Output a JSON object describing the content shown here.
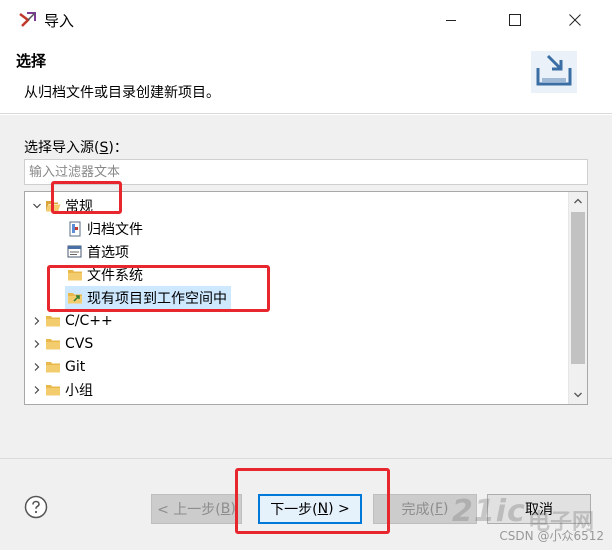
{
  "window": {
    "title": "导入",
    "icon": "eclipse-import-icon",
    "controls": [
      "minimize",
      "maximize",
      "close"
    ]
  },
  "header": {
    "title": "选择",
    "description": "从归档文件或目录创建新项目。",
    "graphic": "import-wizard-graphic"
  },
  "source": {
    "label_prefix": "选择导入源(",
    "label_mnemonic": "S",
    "label_suffix": ")：",
    "filter_placeholder": "输入过滤器文本"
  },
  "tree": {
    "items": [
      {
        "label": "常规",
        "icon": "folder-open-icon",
        "expanded": true
      },
      {
        "label": "归档文件",
        "icon": "archive-file-icon"
      },
      {
        "label": "首选项",
        "icon": "preferences-icon"
      },
      {
        "label": "文件系统",
        "icon": "folder-icon"
      },
      {
        "label": "现有项目到工作空间中",
        "icon": "existing-projects-icon",
        "selected": true
      },
      {
        "label": "C/C++",
        "icon": "folder-icon",
        "expanded": false
      },
      {
        "label": "CVS",
        "icon": "folder-icon",
        "expanded": false
      },
      {
        "label": "Git",
        "icon": "folder-icon",
        "expanded": false
      },
      {
        "label": "小组",
        "icon": "folder-icon",
        "expanded": false
      }
    ]
  },
  "buttons": {
    "back": {
      "prefix": "< 上一步(",
      "mnemonic": "B",
      "suffix": ")",
      "enabled": false
    },
    "next": {
      "prefix": "下一步(",
      "mnemonic": "N",
      "suffix": ") >",
      "enabled": true
    },
    "finish": {
      "prefix": "完成(",
      "mnemonic": "F",
      "suffix": ")",
      "enabled": false
    },
    "cancel": {
      "label": "取消",
      "enabled": true
    }
  },
  "watermark": {
    "logo_text": "21ic",
    "brand_text": "电子网",
    "credit": "CSDN @小众6512"
  },
  "colors": {
    "annotation_red": "#e8262d",
    "selection": "#cde8ff",
    "default_button_border": "#0078d7",
    "folder_yellow": "#e8b84a"
  }
}
